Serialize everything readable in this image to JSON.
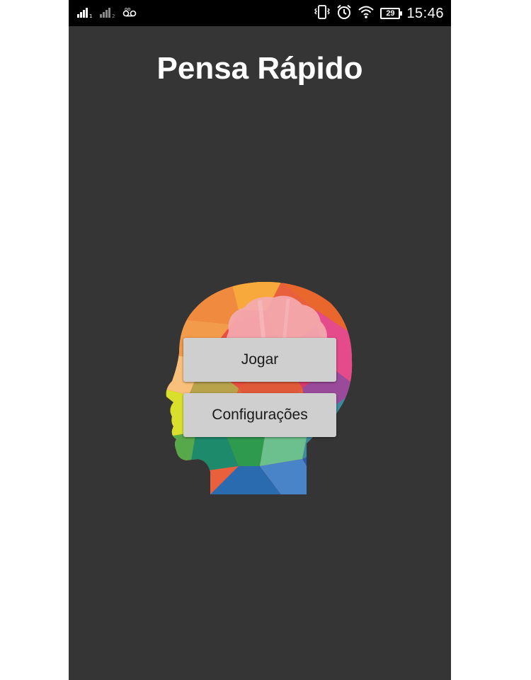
{
  "status_bar": {
    "time": "15:46",
    "battery_level": "29",
    "icons": [
      "signal-icon",
      "signal-2-icon",
      "voicemail-icon",
      "vibrate-icon",
      "alarm-icon",
      "wifi-icon",
      "battery-icon"
    ]
  },
  "app": {
    "title": "Pensa Rápido",
    "logo": "colorful-head-brain-logo"
  },
  "menu": {
    "play_label": "Jogar",
    "settings_label": "Configurações"
  },
  "colors": {
    "background": "#353535",
    "status_bar": "#000000",
    "button": "#cfcfcf",
    "title": "#ffffff"
  }
}
